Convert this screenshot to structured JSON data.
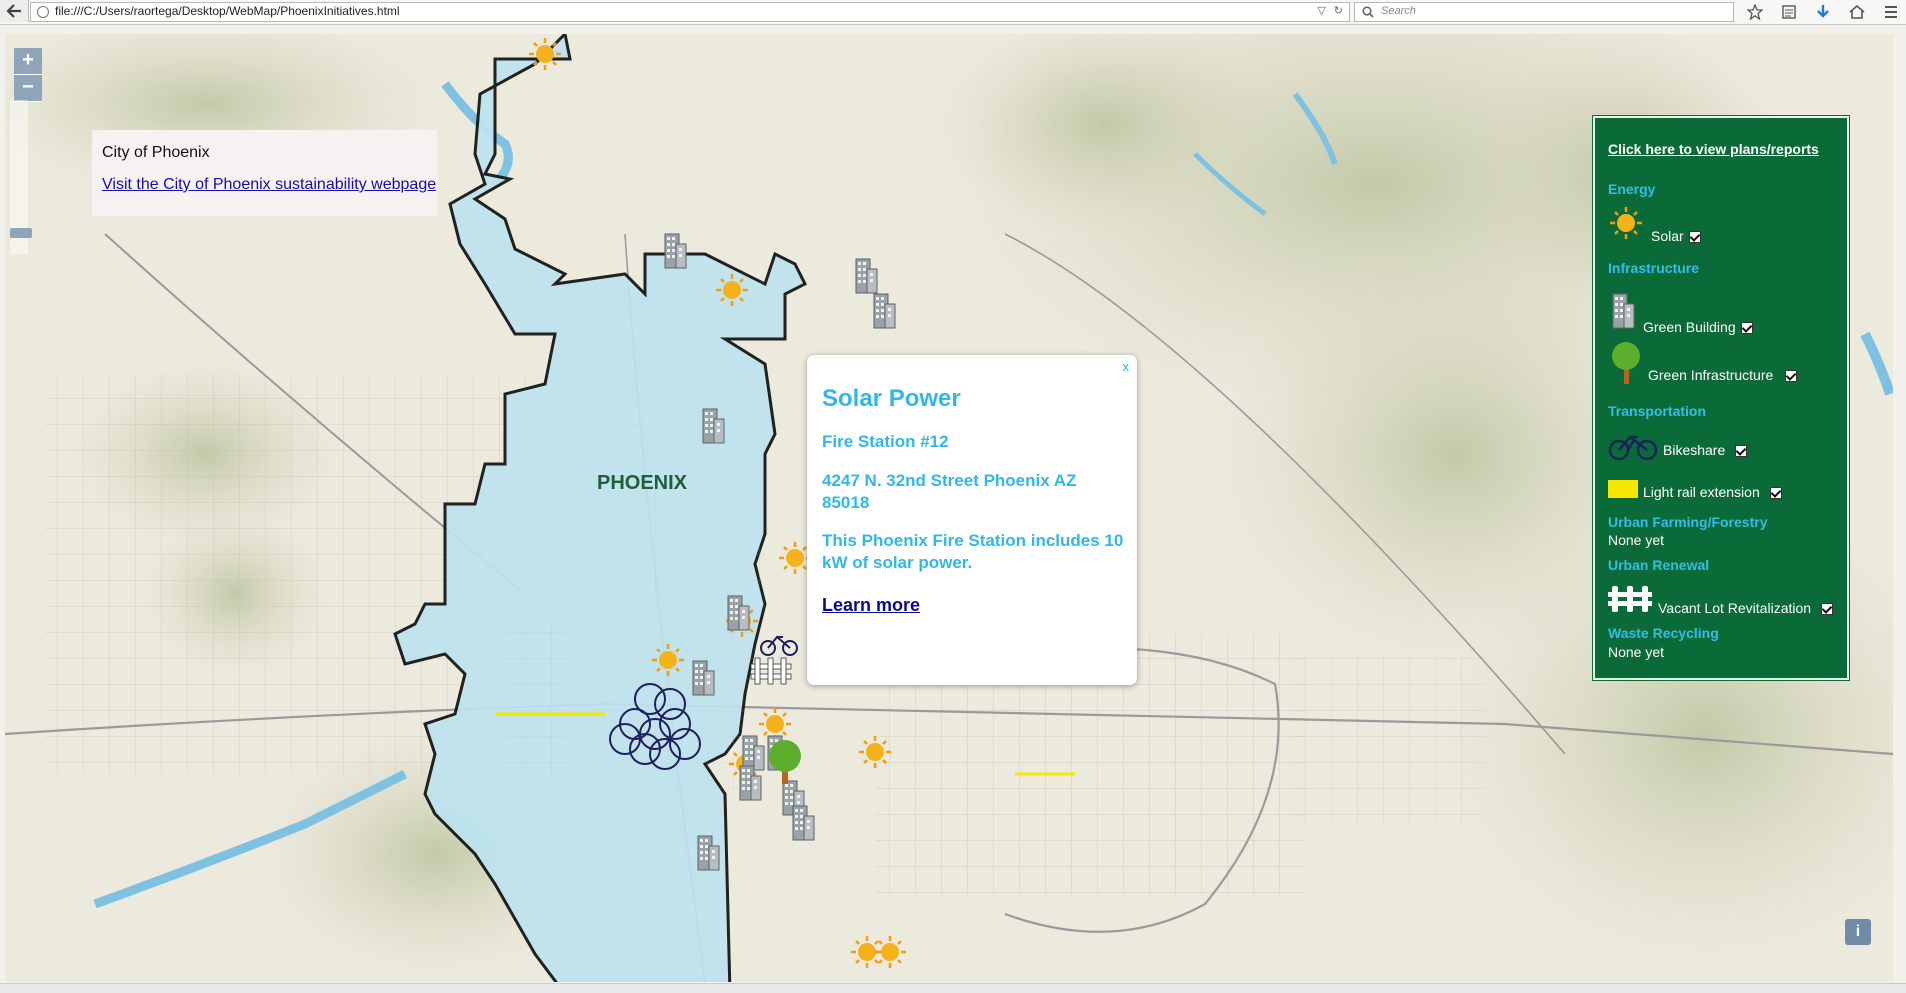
{
  "browser": {
    "url": "file:///C:/Users/raortega/Desktop/WebMap/PhoenixInitiatives.html",
    "search_placeholder": "Search"
  },
  "map": {
    "zoom_in": "+",
    "zoom_out": "−",
    "city_label": "PHOENIX",
    "colors": {
      "city_fill": "#bde3f0",
      "boundary": "#111111",
      "terrain": "#ece9dd",
      "water": "#7fc1e3"
    },
    "marker_icons": [
      "sun-icon",
      "building-icon",
      "tree-icon",
      "bicycle-icon",
      "fence-icon"
    ]
  },
  "info_box": {
    "title": "City of Phoenix",
    "link": "Visit the City of Phoenix sustainability webpage"
  },
  "popup": {
    "close": "x",
    "title": "Solar Power",
    "name": "Fire Station #12",
    "address": "4247 N. 32nd Street Phoenix AZ 85018",
    "description": "This Phoenix Fire Station includes 10 kW of solar power.",
    "link": "Learn more"
  },
  "legend": {
    "plans_link": "Click here to view plans/reports",
    "energy": "Energy",
    "solar": "Solar",
    "infrastructure": "Infrastructure",
    "green_building": "Green Building",
    "green_infrastructure": "Green Infrastructure",
    "transportation": "Transportation",
    "bikeshare": "Bikeshare",
    "light_rail": "Light rail extension",
    "urban_farming": "Urban Farming/Forestry",
    "urban_farming_value": "None yet",
    "urban_renewal": "Urban Renewal",
    "vacant_lot": "Vacant Lot Revitalization",
    "waste_recycling": "Waste Recycling",
    "waste_recycling_value": "None yet",
    "colors": {
      "background": "#0b6b38",
      "heading": "#33bde9",
      "light_rail": "#f7e600"
    }
  },
  "attribution_button": "i"
}
